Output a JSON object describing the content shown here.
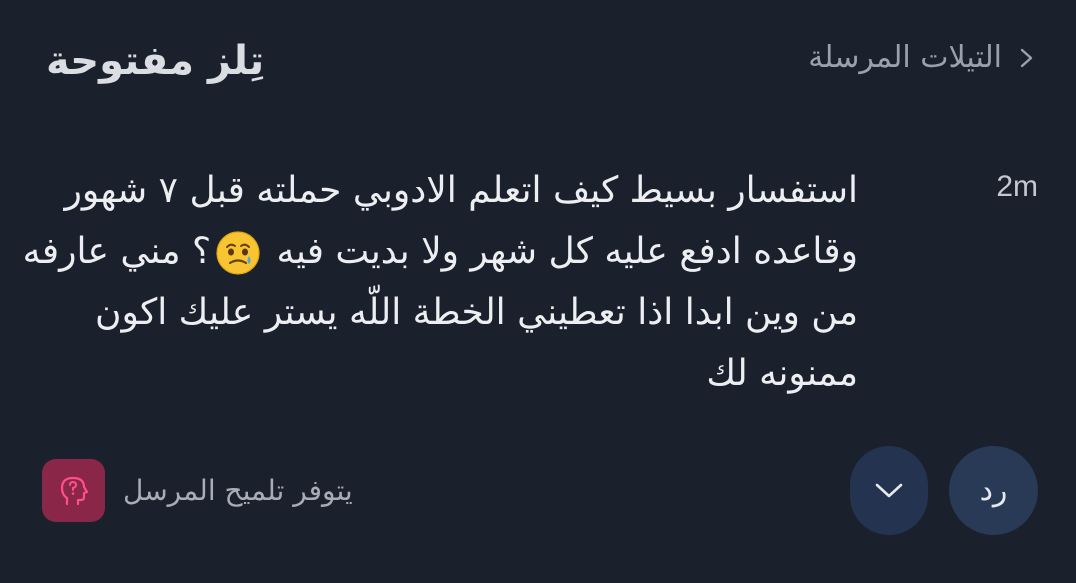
{
  "header": {
    "title": "تِلز مفتوحة",
    "back_label": "التيلات المرسلة",
    "back_icon": "chevron-right-icon"
  },
  "message": {
    "timestamp": "2m",
    "lines": [
      "استفسار بسيط كيف اتعلم الادوبي حملته قبل ٧ شهور",
      "وقاعده ادفع عليه كل شهر ولا بديت فيه",
      "؟ مني عارفه",
      "من وين ابدا اذا تعطيني الخطة اللّه يستر عليك اكون",
      "ممنونه لك"
    ],
    "emoji": "crying-face-emoji"
  },
  "footer": {
    "hint_text": "يتوفر تلميح المرسل",
    "hint_icon": "head-question-icon",
    "reply_label": "رد",
    "more_icon": "chevron-down-icon"
  },
  "colors": {
    "background": "#1b212c",
    "button": "#283a56",
    "hint_badge": "#8a2648",
    "hint_icon": "#ff4f8b"
  }
}
